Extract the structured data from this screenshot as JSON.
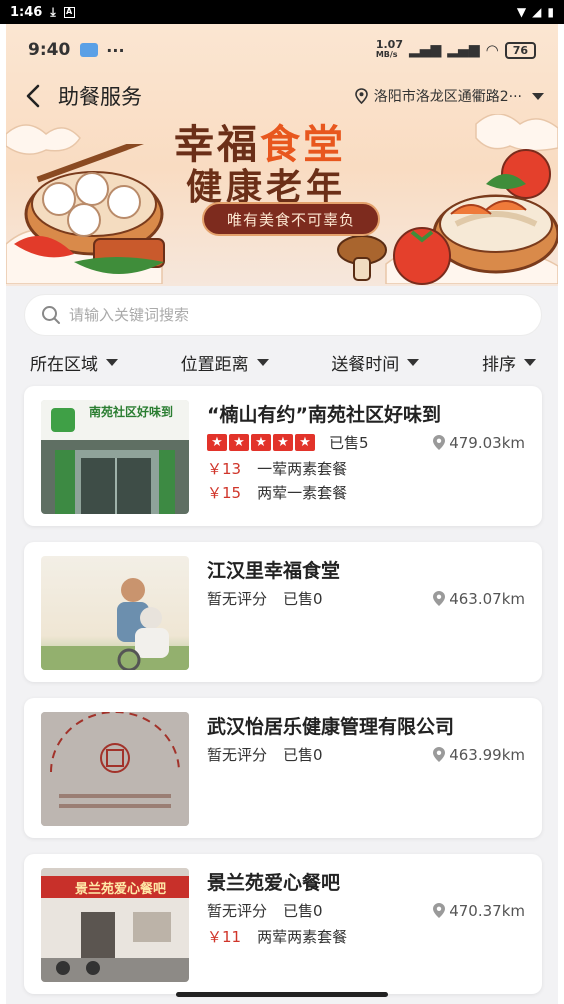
{
  "system_bar": {
    "time": "1:46"
  },
  "header": {
    "inner_time": "9:40",
    "net_speed": "1.07",
    "net_unit": "MB/s",
    "battery": "76",
    "title": "助餐服务",
    "location": "洛阳市洛龙区通衢路2···"
  },
  "banner": {
    "headline_part1": "幸福",
    "headline_part2": "食堂",
    "headline_line2": "健康老年",
    "slogan": "唯有美食不可辜负"
  },
  "search": {
    "placeholder": "请输入关键词搜索"
  },
  "filters": [
    {
      "label": "所在区域"
    },
    {
      "label": "位置距离"
    },
    {
      "label": "送餐时间"
    },
    {
      "label": "排序"
    }
  ],
  "restaurants": [
    {
      "name": "“楠山有约”南苑社区好味到",
      "rating_stars": 5,
      "sold": "已售5",
      "distance": "479.03km",
      "image_sign": "南苑社区好味到",
      "meals": [
        {
          "price": "￥13",
          "name": "一荤两素套餐"
        },
        {
          "price": "￥15",
          "name": "两荤一素套餐"
        }
      ]
    },
    {
      "name": "江汉里幸福食堂",
      "rating": "暂无评分",
      "sold": "已售0",
      "distance": "463.07km",
      "meals": []
    },
    {
      "name": "武汉怡居乐健康管理有限公司",
      "rating": "暂无评分",
      "sold": "已售0",
      "distance": "463.99km",
      "meals": []
    },
    {
      "name": "景兰苑爱心餐吧",
      "rating": "暂无评分",
      "sold": "已售0",
      "distance": "470.37km",
      "image_sign": "景兰苑爱心餐吧",
      "meals": [
        {
          "price": "￥11",
          "name": "两荤两素套餐"
        }
      ]
    }
  ],
  "colors": {
    "price": "#d0352a",
    "star": "#e2332a",
    "banner_title": "#6b2f18",
    "banner_accent": "#e8571e"
  }
}
